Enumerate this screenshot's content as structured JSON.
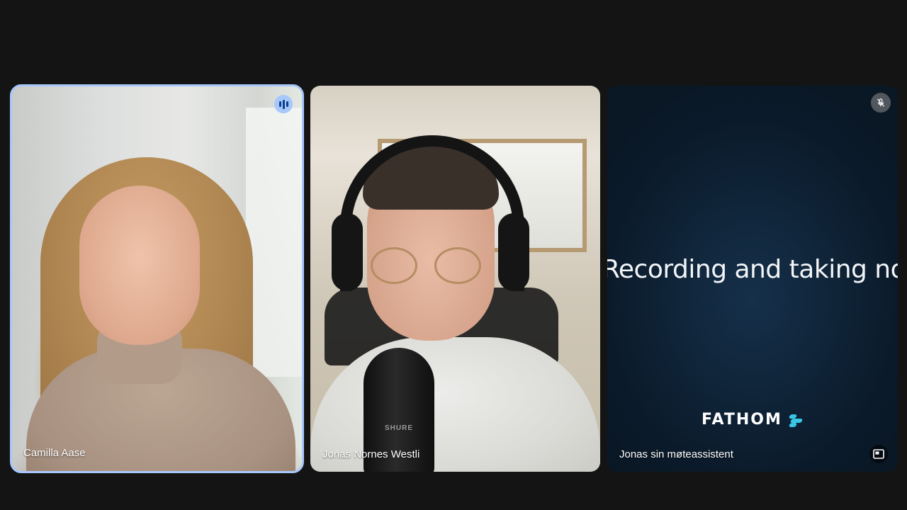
{
  "participants": [
    {
      "name": "Camilla Aase",
      "speaking": true,
      "icon": "speaking-indicator-icon"
    },
    {
      "name": "Jonas Nornes Westli",
      "mic_brand": "SHURE"
    },
    {
      "name": "Jonas sin møteassistent",
      "muted": true,
      "icon": "mic-off-icon",
      "overlay_text": "Recording and taking notes",
      "brand": "FATHOM",
      "action_icon": "picture-in-picture-icon"
    }
  ],
  "colors": {
    "background": "#141414",
    "active_speaker_border": "#a8c7fa",
    "fathom_accent": "#39c6e6",
    "fathom_background": "#0f2438"
  }
}
